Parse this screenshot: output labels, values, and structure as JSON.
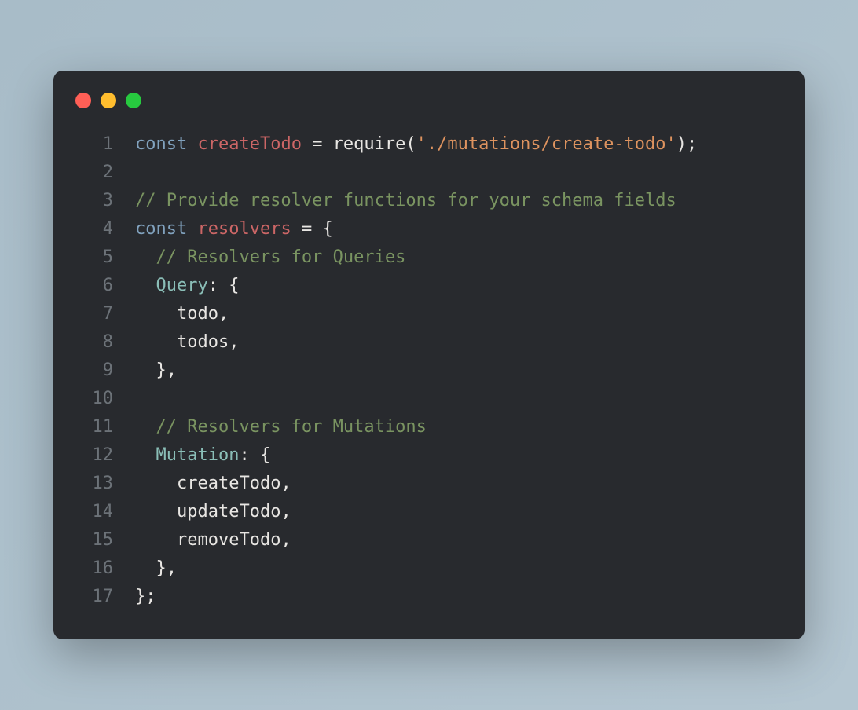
{
  "window": {
    "traffic_lights": [
      "red",
      "yellow",
      "green"
    ]
  },
  "code": {
    "lines": [
      {
        "num": "1",
        "tokens": [
          {
            "cls": "keyword",
            "text": "const"
          },
          {
            "cls": "punct",
            "text": " "
          },
          {
            "cls": "variable",
            "text": "createTodo"
          },
          {
            "cls": "punct",
            "text": " "
          },
          {
            "cls": "operator",
            "text": "="
          },
          {
            "cls": "punct",
            "text": " "
          },
          {
            "cls": "function",
            "text": "require"
          },
          {
            "cls": "punct",
            "text": "("
          },
          {
            "cls": "string",
            "text": "'./mutations/create-todo'"
          },
          {
            "cls": "punct",
            "text": ");"
          }
        ]
      },
      {
        "num": "2",
        "tokens": []
      },
      {
        "num": "3",
        "tokens": [
          {
            "cls": "comment",
            "text": "// Provide resolver functions for your schema fields"
          }
        ]
      },
      {
        "num": "4",
        "tokens": [
          {
            "cls": "keyword",
            "text": "const"
          },
          {
            "cls": "punct",
            "text": " "
          },
          {
            "cls": "variable",
            "text": "resolvers"
          },
          {
            "cls": "punct",
            "text": " "
          },
          {
            "cls": "operator",
            "text": "="
          },
          {
            "cls": "punct",
            "text": " {"
          }
        ]
      },
      {
        "num": "5",
        "tokens": [
          {
            "cls": "punct",
            "text": "  "
          },
          {
            "cls": "comment",
            "text": "// Resolvers for Queries"
          }
        ]
      },
      {
        "num": "6",
        "tokens": [
          {
            "cls": "punct",
            "text": "  "
          },
          {
            "cls": "property",
            "text": "Query"
          },
          {
            "cls": "punct",
            "text": ": {"
          }
        ]
      },
      {
        "num": "7",
        "tokens": [
          {
            "cls": "punct",
            "text": "    "
          },
          {
            "cls": "identifier",
            "text": "todo"
          },
          {
            "cls": "punct",
            "text": ","
          }
        ]
      },
      {
        "num": "8",
        "tokens": [
          {
            "cls": "punct",
            "text": "    "
          },
          {
            "cls": "identifier",
            "text": "todos"
          },
          {
            "cls": "punct",
            "text": ","
          }
        ]
      },
      {
        "num": "9",
        "tokens": [
          {
            "cls": "punct",
            "text": "  },"
          }
        ]
      },
      {
        "num": "10",
        "tokens": []
      },
      {
        "num": "11",
        "tokens": [
          {
            "cls": "punct",
            "text": "  "
          },
          {
            "cls": "comment",
            "text": "// Resolvers for Mutations"
          }
        ]
      },
      {
        "num": "12",
        "tokens": [
          {
            "cls": "punct",
            "text": "  "
          },
          {
            "cls": "property",
            "text": "Mutation"
          },
          {
            "cls": "punct",
            "text": ": {"
          }
        ]
      },
      {
        "num": "13",
        "tokens": [
          {
            "cls": "punct",
            "text": "    "
          },
          {
            "cls": "identifier",
            "text": "createTodo"
          },
          {
            "cls": "punct",
            "text": ","
          }
        ]
      },
      {
        "num": "14",
        "tokens": [
          {
            "cls": "punct",
            "text": "    "
          },
          {
            "cls": "identifier",
            "text": "updateTodo"
          },
          {
            "cls": "punct",
            "text": ","
          }
        ]
      },
      {
        "num": "15",
        "tokens": [
          {
            "cls": "punct",
            "text": "    "
          },
          {
            "cls": "identifier",
            "text": "removeTodo"
          },
          {
            "cls": "punct",
            "text": ","
          }
        ]
      },
      {
        "num": "16",
        "tokens": [
          {
            "cls": "punct",
            "text": "  },"
          }
        ]
      },
      {
        "num": "17",
        "tokens": [
          {
            "cls": "punct",
            "text": "};"
          }
        ]
      }
    ]
  }
}
